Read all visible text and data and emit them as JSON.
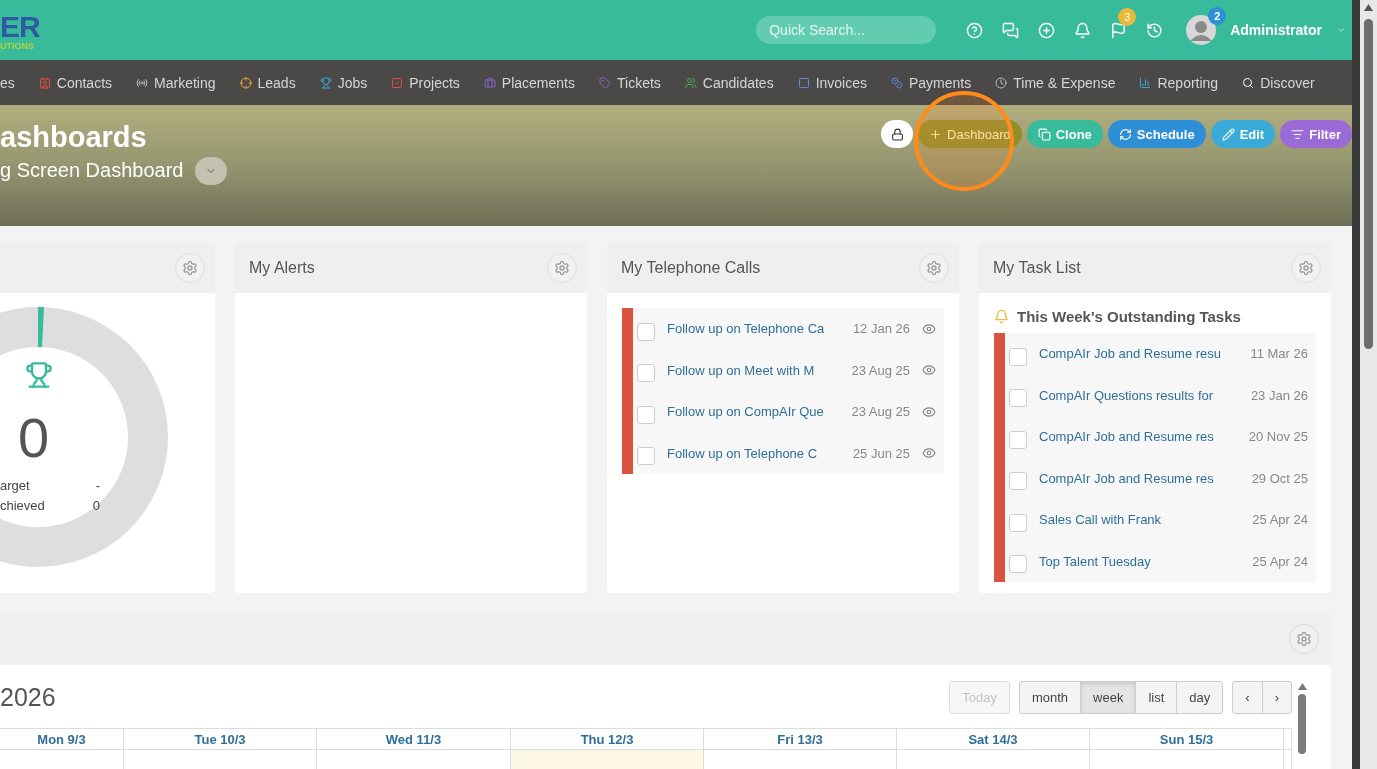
{
  "logo": {
    "word": "ER",
    "tagline": "UTIONS"
  },
  "search": {
    "placeholder": "Quick Search..."
  },
  "header_icons": [
    {
      "kind": "help"
    },
    {
      "kind": "chat"
    },
    {
      "kind": "add"
    },
    {
      "kind": "bell"
    },
    {
      "kind": "flag",
      "badge": "3"
    },
    {
      "kind": "history"
    }
  ],
  "user": {
    "name": "Administrator",
    "badge": "2"
  },
  "nav": [
    {
      "label": "es",
      "kind": "none"
    },
    {
      "label": "Contacts",
      "kind": "contact"
    },
    {
      "label": "Marketing",
      "kind": "radio"
    },
    {
      "label": "Leads",
      "kind": "target"
    },
    {
      "label": "Jobs",
      "kind": "trophy"
    },
    {
      "label": "Projects",
      "kind": "check"
    },
    {
      "label": "Placements",
      "kind": "briefcase"
    },
    {
      "label": "Tickets",
      "kind": "tag"
    },
    {
      "label": "Candidates",
      "kind": "users"
    },
    {
      "label": "Invoices",
      "kind": "square"
    },
    {
      "label": "Payments",
      "kind": "coins"
    },
    {
      "label": "Time & Expense",
      "kind": "clock"
    },
    {
      "label": "Reporting",
      "kind": "chart"
    },
    {
      "label": "Discover",
      "kind": "search"
    }
  ],
  "page": {
    "title": "ashboards",
    "subtitle": "g Screen Dashboard"
  },
  "actions": [
    {
      "kind": "lock"
    },
    {
      "kind": "dashboard",
      "label": "Dashboard"
    },
    {
      "kind": "clone",
      "label": "Clone"
    },
    {
      "kind": "schedule",
      "label": "Schedule"
    },
    {
      "kind": "edit",
      "label": "Edit"
    },
    {
      "kind": "filter",
      "label": "Filter"
    }
  ],
  "goal_widget": {
    "value": "0",
    "rows": [
      {
        "label": "arget",
        "value": "-"
      },
      {
        "label": "chieved",
        "value": "0"
      }
    ]
  },
  "alerts_widget": {
    "title": "My Alerts"
  },
  "calls_widget": {
    "title": "My Telephone Calls",
    "rows": [
      {
        "title": "Follow up on Telephone Ca",
        "date": "12 Jan 26",
        "checked": false,
        "color": "#d9533f"
      },
      {
        "title": "Follow up on Meet with M",
        "date": "23 Aug 25",
        "checked": false,
        "color": "#d9533f"
      },
      {
        "title": "Follow up on CompAIr Que",
        "date": "23 Aug 25",
        "checked": false,
        "color": "#d9533f"
      },
      {
        "title": "Follow up on Telephone C",
        "date": "25 Jun 25",
        "checked": false,
        "color": "#d9533f"
      }
    ]
  },
  "tasks_widget": {
    "title": "My Task List",
    "heading": "This Week's Outstanding Tasks",
    "rows": [
      {
        "title": "CompAIr Job and Resume resu",
        "date": "11 Mar 26",
        "checked": false,
        "color": "#d9533f"
      },
      {
        "title": "CompAIr Questions results for",
        "date": "23 Jan 26",
        "checked": false,
        "color": "#d9533f"
      },
      {
        "title": "CompAIr Job and Resume res",
        "date": "20 Nov 25",
        "checked": false,
        "color": "#d9533f"
      },
      {
        "title": "CompAIr Job and Resume res",
        "date": "29 Oct 25",
        "checked": false,
        "color": "#d9533f"
      },
      {
        "title": "Sales Call with Frank",
        "date": "25 Apr 24",
        "checked": false,
        "color": "#d9533f"
      },
      {
        "title": "Top Talent Tuesday",
        "date": "25 Apr 24",
        "checked": false,
        "color": "#d9533f"
      }
    ]
  },
  "calendar": {
    "title": "2026",
    "today_button": {
      "label": "Today",
      "disabled": true
    },
    "views": [
      {
        "label": "month",
        "selected": false
      },
      {
        "label": "week",
        "selected": true
      },
      {
        "label": "list",
        "selected": false
      },
      {
        "label": "day",
        "selected": false
      }
    ],
    "prev": "‹",
    "next": "›",
    "days": [
      {
        "label": "Mon 9/3",
        "today": false
      },
      {
        "label": "Tue 10/3",
        "today": false
      },
      {
        "label": "Wed 11/3",
        "today": false
      },
      {
        "label": "Thu 12/3",
        "today": true
      },
      {
        "label": "Fri 13/3",
        "today": false
      },
      {
        "label": "Sat 14/3",
        "today": false
      },
      {
        "label": "Sun 15/3",
        "today": false
      }
    ]
  }
}
